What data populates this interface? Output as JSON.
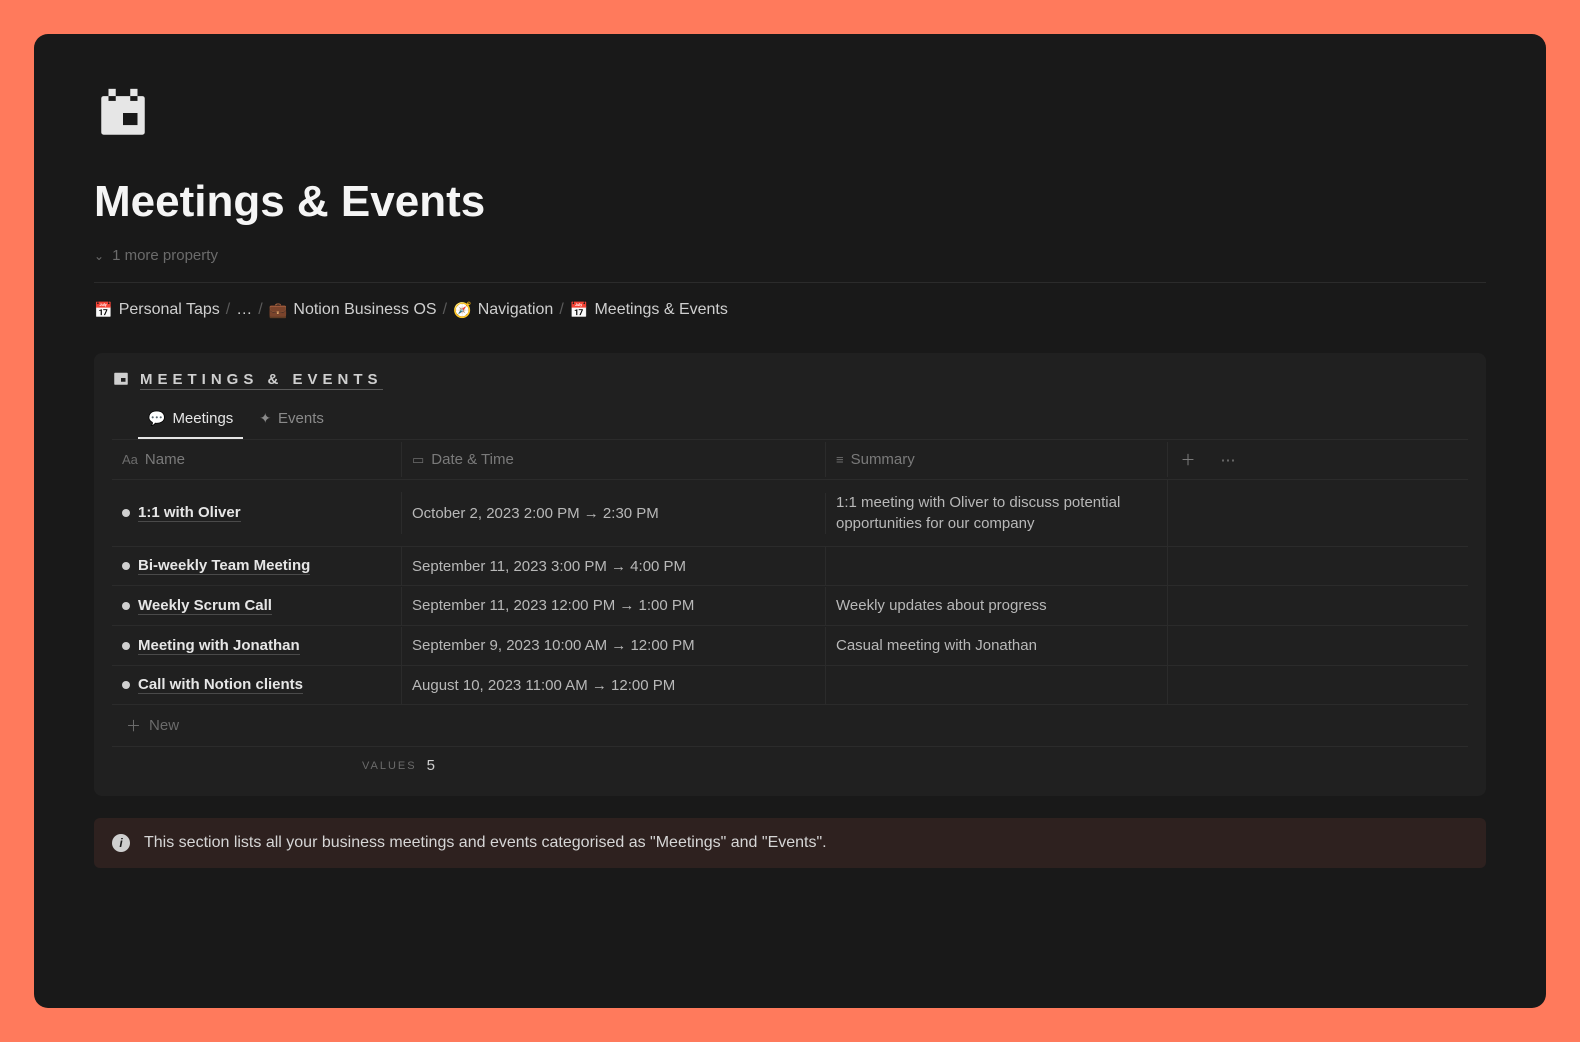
{
  "page": {
    "title": "Meetings & Events",
    "more_properties": "1 more property"
  },
  "breadcrumb": {
    "items": [
      {
        "icon": "📅",
        "label": "Personal Taps"
      },
      {
        "icon": "",
        "label": "…"
      },
      {
        "icon": "💼",
        "label": "Notion Business OS"
      },
      {
        "icon": "🧭",
        "label": "Navigation"
      },
      {
        "icon": "📅",
        "label": "Meetings & Events"
      }
    ]
  },
  "database": {
    "title": "MEETINGS & EVENTS",
    "tabs": [
      {
        "icon": "💬",
        "label": "Meetings",
        "active": true
      },
      {
        "icon": "✦",
        "label": "Events",
        "active": false
      }
    ],
    "columns": {
      "name": "Name",
      "datetime": "Date & Time",
      "summary": "Summary"
    },
    "rows": [
      {
        "name": "1:1 with Oliver",
        "datetime": "October 2, 2023 2:00 PM → 2:30 PM",
        "summary": "1:1 meeting with Oliver to discuss potential opportunities for our company"
      },
      {
        "name": "Bi-weekly Team Meeting",
        "datetime": "September 11, 2023 3:00 PM → 4:00 PM",
        "summary": ""
      },
      {
        "name": "Weekly Scrum Call",
        "datetime": "September 11, 2023 12:00 PM → 1:00 PM",
        "summary": "Weekly updates about progress"
      },
      {
        "name": "Meeting with Jonathan",
        "datetime": "September 9, 2023 10:00 AM → 12:00 PM",
        "summary": "Casual meeting with Jonathan"
      },
      {
        "name": "Call with Notion clients",
        "datetime": "August 10, 2023 11:00 AM → 12:00 PM",
        "summary": ""
      }
    ],
    "new_label": "New",
    "footer": {
      "values_label": "VALUES",
      "values_count": "5"
    }
  },
  "callout": {
    "text": "This section lists all your business meetings and events categorised as \"Meetings\" and \"Events\"."
  }
}
